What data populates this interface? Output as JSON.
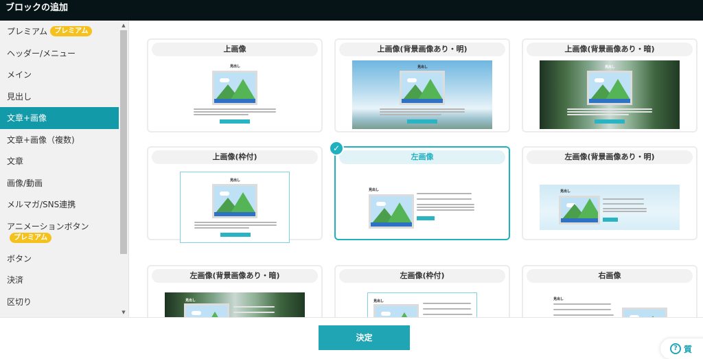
{
  "titlebar": {
    "title": "ブロックの追加"
  },
  "sidebar": {
    "items": [
      {
        "label": "プレミアム",
        "badge": "プレミアム"
      },
      {
        "label": "ヘッダー/メニュー"
      },
      {
        "label": "メイン"
      },
      {
        "label": "見出し"
      },
      {
        "label": "文章+画像",
        "active": true
      },
      {
        "label": "文章+画像（複数)"
      },
      {
        "label": "文章"
      },
      {
        "label": "画像/動画"
      },
      {
        "label": "メルマガ/SNS連携"
      },
      {
        "label": "アニメーションボタン",
        "badge": "プレミアム"
      },
      {
        "label": "ボタン"
      },
      {
        "label": "決済"
      },
      {
        "label": "区切り"
      }
    ]
  },
  "cards": [
    {
      "title": "上画像",
      "preview_heading": "見出し"
    },
    {
      "title": "上画像(背景画像あり・明)",
      "preview_heading": "見出し"
    },
    {
      "title": "上画像(背景画像あり・暗)",
      "preview_heading": "見出し"
    },
    {
      "title": "上画像(枠付)",
      "preview_heading": "見出し"
    },
    {
      "title": "左画像",
      "preview_heading": "見出し",
      "selected": true
    },
    {
      "title": "左画像(背景画像あり・明)",
      "preview_heading": "見出し"
    },
    {
      "title": "左画像(背景画像あり・暗)",
      "preview_heading": "見出し"
    },
    {
      "title": "左画像(枠付)",
      "preview_heading": "見出し"
    },
    {
      "title": "右画像",
      "preview_heading": "見出し"
    }
  ],
  "selected_check": "✓",
  "footer": {
    "decide_label": "決定"
  },
  "help": {
    "label": "質",
    "icon": "?"
  },
  "colors": {
    "accent": "#1fa5b3",
    "titlebar": "#061417",
    "badge": "#f5c11e"
  },
  "icons": [
    "chevron-up-icon",
    "chevron-down-icon",
    "check-icon",
    "help-icon"
  ]
}
